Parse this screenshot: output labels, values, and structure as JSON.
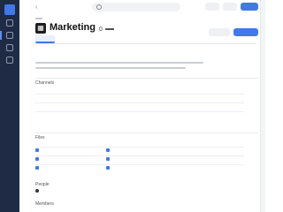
{
  "app": {
    "rail_items": [
      {
        "name": "logo-icon",
        "active": true
      },
      {
        "name": "grid-icon"
      },
      {
        "name": "unit-icon",
        "active": true
      },
      {
        "name": "bell-icon"
      },
      {
        "name": "list-icon"
      }
    ],
    "search": {
      "placeholder": ""
    },
    "topbar": {
      "back": "‹"
    }
  },
  "unit": {
    "title": "Marketing",
    "badge": "",
    "count": "0",
    "icon_glyph": "▦"
  },
  "tabs": [
    {
      "label": "",
      "active": true
    },
    {
      "label": "",
      "active": false
    },
    {
      "label": "",
      "active": false
    },
    {
      "label": "",
      "active": false
    },
    {
      "label": "",
      "active": false
    },
    {
      "label": "",
      "active": false
    },
    {
      "label": "",
      "active": false
    }
  ],
  "description": {
    "heading": "",
    "text": ""
  },
  "channels_section": {
    "label": "Channels",
    "columns": [
      "",
      "",
      ""
    ],
    "rows": [
      {
        "name": "",
        "type": "",
        "note": ""
      },
      {
        "name": "",
        "type": "",
        "note": ""
      },
      {
        "name": "",
        "type": "",
        "note": ""
      }
    ],
    "more": ""
  },
  "files_section": {
    "label": "Files",
    "columns": [
      "",
      "",
      ""
    ],
    "rows": [
      {
        "name": "",
        "type": "",
        "note": ""
      },
      {
        "name": "",
        "type": "",
        "note": ""
      },
      {
        "name": "",
        "type": "",
        "note": ""
      }
    ],
    "more": ""
  },
  "people_section": {
    "label": "People",
    "person_name": ""
  },
  "members_section": {
    "label": "Members"
  },
  "colors": {
    "rail": "#1f2b44",
    "accent": "#3f7ae6",
    "link": "#3f7ae6",
    "text": "#222222",
    "muted": "#c6c9d0"
  }
}
